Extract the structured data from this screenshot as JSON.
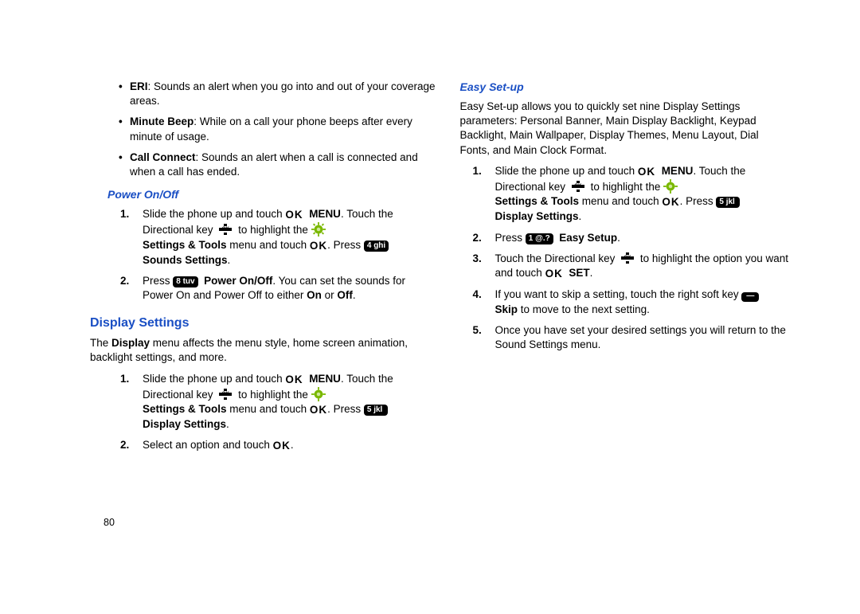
{
  "page_number": "80",
  "left": {
    "bullets": [
      {
        "term": "ERI",
        "text": ": Sounds an alert when you go into and out of your coverage areas."
      },
      {
        "term": "Minute Beep",
        "text": ": While on a call your phone beeps after every minute of usage."
      },
      {
        "term": "Call Connect",
        "text": ": Sounds an alert when a call is connected and when a call has ended."
      }
    ],
    "power_heading": "Power On/Off",
    "power_steps": {
      "s1a": "Slide the phone up and touch ",
      "s1_menu": "MENU",
      "s1b": ". Touch the Directional key ",
      "s1c": " to highlight the ",
      "s1d": "Settings & Tools",
      "s1e": " menu and touch ",
      "s1f": ". Press ",
      "s1_key4": "4 ghi",
      "s1g": "Sounds Settings",
      "s2a": "Press ",
      "s2_key8": "8 tuv",
      "s2b": "Power On/Off",
      "s2c": ". You can set the sounds for Power On and Power Off to either ",
      "s2_on": "On",
      "s2_or": " or ",
      "s2_off": "Off",
      "s2_end": "."
    },
    "display_heading": "Display Settings",
    "display_intro_a": "The ",
    "display_intro_b": "Display",
    "display_intro_c": " menu affects the menu style, home screen animation, backlight settings, and more.",
    "display_steps": {
      "s1a": "Slide the phone up and touch ",
      "s1_menu": "MENU",
      "s1b": ". Touch the Directional key ",
      "s1c": " to highlight the ",
      "s1d": "Settings & Tools",
      "s1e": " menu and touch ",
      "s1f": ". Press ",
      "s1_key5": "5 jkl",
      "s1g": "Display Settings",
      "s2a": "Select an option and touch ",
      "s2_end": "."
    }
  },
  "right": {
    "easy_heading": "Easy Set-up",
    "intro": "Easy Set-up allows you to quickly set nine Display Settings parameters: Personal Banner, Main Display Backlight, Keypad Backlight, Main Wallpaper, Display Themes, Menu Layout, Dial Fonts, and Main Clock Format.",
    "steps": {
      "s1a": "Slide the phone up and touch ",
      "s1_menu": "MENU",
      "s1b": ". Touch the Directional key ",
      "s1c": " to highlight the ",
      "s1d": "Settings & Tools",
      "s1e": " menu and touch ",
      "s1f": ". Press ",
      "s1_key5": "5 jkl",
      "s1g": "Display Settings",
      "s2a": "Press ",
      "s2_key1": "1 @.?",
      "s2b": "Easy Setup",
      "s2_end": ".",
      "s3a": "Touch the Directional key ",
      "s3b": " to highlight the option you want and touch ",
      "s3_set": "SET",
      "s3_end": ".",
      "s4a": "If you want to skip a setting, touch the right soft key ",
      "s4_skip": "Skip",
      "s4b": " to move to the next setting.",
      "s5": "Once you have set your desired settings you will return to the Sound Settings menu."
    }
  }
}
